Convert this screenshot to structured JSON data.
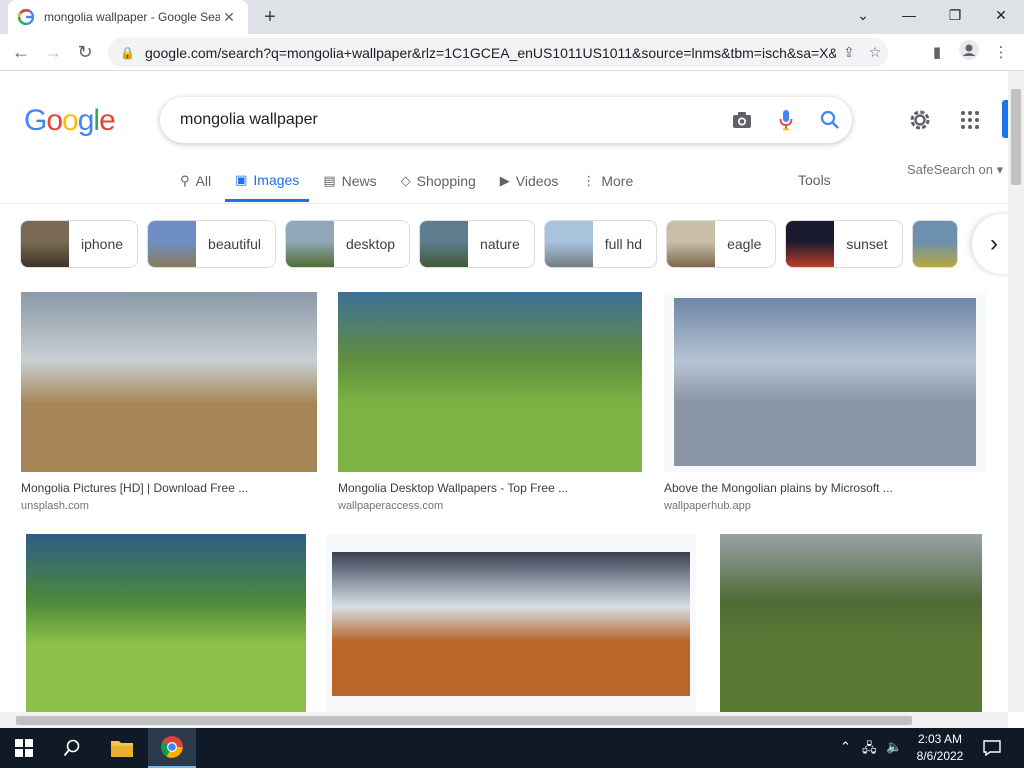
{
  "browser": {
    "tab_title": "mongolia wallpaper - Google Search",
    "tab_close": "✕",
    "new_tab": "+",
    "url": "google.com/search?q=mongolia+wallpaper&rlz=1C1GCEA_enUS1011US1011&source=lnms&tbm=isch&sa=X&..."
  },
  "google": {
    "logo_letters": [
      "G",
      "o",
      "o",
      "g",
      "l",
      "e"
    ],
    "logo_colors": [
      "#4285f4",
      "#ea4335",
      "#fbbc05",
      "#4285f4",
      "#34a853",
      "#ea4335"
    ],
    "query": "mongolia wallpaper"
  },
  "nav_tabs": [
    {
      "icon": "search-icon",
      "glyph": "⚲",
      "label": "All"
    },
    {
      "icon": "images-icon",
      "glyph": "▣",
      "label": "Images"
    },
    {
      "icon": "news-icon",
      "glyph": "▤",
      "label": "News"
    },
    {
      "icon": "shopping-icon",
      "glyph": "◇",
      "label": "Shopping"
    },
    {
      "icon": "videos-icon",
      "glyph": "▶",
      "label": "Videos"
    },
    {
      "icon": "more-icon",
      "glyph": "⋮",
      "label": "More"
    }
  ],
  "tools_label": "Tools",
  "safesearch_label": "SafeSearch on ▾",
  "chips": [
    {
      "label": "iphone",
      "thumb_colors": [
        "#7a6a55",
        "#3b2f25"
      ]
    },
    {
      "label": "beautiful",
      "thumb_colors": [
        "#6f8fc4",
        "#8a7a55"
      ]
    },
    {
      "label": "desktop",
      "thumb_colors": [
        "#8fa7b8",
        "#4e6b2d"
      ]
    },
    {
      "label": "nature",
      "thumb_colors": [
        "#5e7d8e",
        "#3f5a32"
      ]
    },
    {
      "label": "full hd",
      "thumb_colors": [
        "#a9c3dd",
        "#6f7a80"
      ]
    },
    {
      "label": "eagle",
      "thumb_colors": [
        "#c9bfa8",
        "#7a6448"
      ]
    },
    {
      "label": "sunset",
      "thumb_colors": [
        "#1a1a2e",
        "#c0402a"
      ]
    },
    {
      "label": "",
      "thumb_colors": [
        "#6d8fb0",
        "#b9a93c"
      ]
    }
  ],
  "results": [
    {
      "title": "Mongolia Pictures [HD] | Download Free ...",
      "source": "unsplash.com",
      "colors": [
        "#8a9aa8",
        "#c9cfd3",
        "#a68657"
      ]
    },
    {
      "title": "Mongolia Desktop Wallpapers - Top Free ...",
      "source": "wallpaperaccess.com",
      "colors": [
        "#3f6f95",
        "#5f8f3f",
        "#7cb342"
      ]
    },
    {
      "title": "Above the Mongolian plains by Microsoft ...",
      "source": "wallpaperhub.app",
      "colors": [
        "#6f86a5",
        "#b7c4d4",
        "#8a96a5"
      ]
    },
    {
      "title": "",
      "source": "",
      "colors": [
        "#2e5c86",
        "#4c8a3a",
        "#8cc04a"
      ]
    },
    {
      "title": "",
      "source": "",
      "colors": [
        "#3a3f52",
        "#d8dfe8",
        "#b8662a"
      ]
    },
    {
      "title": "",
      "source": "",
      "colors": [
        "#9aa2a8",
        "#4e6b36",
        "#5a7a33"
      ]
    }
  ],
  "taskbar": {
    "time": "2:03 AM",
    "date": "8/6/2022"
  }
}
